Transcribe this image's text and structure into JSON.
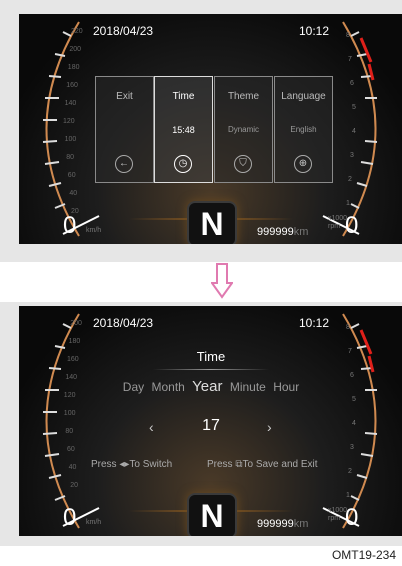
{
  "top": {
    "date": "2018/04/23",
    "clock": "10:12",
    "speed_zero": "0",
    "speed_unit": "km/h",
    "rpm_zero": "0",
    "rpm_unit_1": "x1000",
    "rpm_unit_2": "rpm",
    "odometer": "999999",
    "odometer_unit": "km",
    "gear": "N",
    "menu": [
      {
        "label": "Exit",
        "value": "",
        "icon": "back-arrow-icon"
      },
      {
        "label": "Time",
        "value": "15:48",
        "icon": "clock-icon"
      },
      {
        "label": "Theme",
        "value": "Dynamic",
        "icon": "shirt-icon"
      },
      {
        "label": "Language",
        "value": "English",
        "icon": "globe-icon"
      }
    ],
    "speed_ticks": [
      "220",
      "200",
      "180",
      "160",
      "140",
      "120",
      "100",
      "80",
      "60",
      "40",
      "20"
    ],
    "rpm_ticks": [
      "8",
      "7",
      "6",
      "5",
      "4",
      "3",
      "2",
      "1"
    ]
  },
  "bottom": {
    "date": "2018/04/23",
    "clock": "10:12",
    "speed_zero": "0",
    "speed_unit": "km/h",
    "rpm_zero": "0",
    "rpm_unit_1": "x1000",
    "rpm_unit_2": "rpm",
    "odometer": "999999",
    "odometer_unit": "km",
    "gear": "N",
    "title": "Time",
    "fields": [
      "Day",
      "Month",
      "Year",
      "Minute",
      "Hour"
    ],
    "active_field": "Year",
    "value": "17",
    "left_arrow": "‹",
    "right_arrow": "›",
    "hint_switch": "Press ◂▸To Switch",
    "hint_save": "Press ⧉To Save and Exit",
    "speed_ticks": [
      "200",
      "180",
      "160",
      "140",
      "120",
      "100",
      "80",
      "60",
      "40",
      "20"
    ],
    "rpm_ticks": [
      "8",
      "7",
      "6",
      "5",
      "4",
      "3",
      "2",
      "1"
    ]
  },
  "caption": "OMT19-234",
  "colors": {
    "frame": "#e6e6e6",
    "arrow": "#f0a0c8",
    "redline": "#e0201a",
    "dial_edge": "#d08a50"
  }
}
